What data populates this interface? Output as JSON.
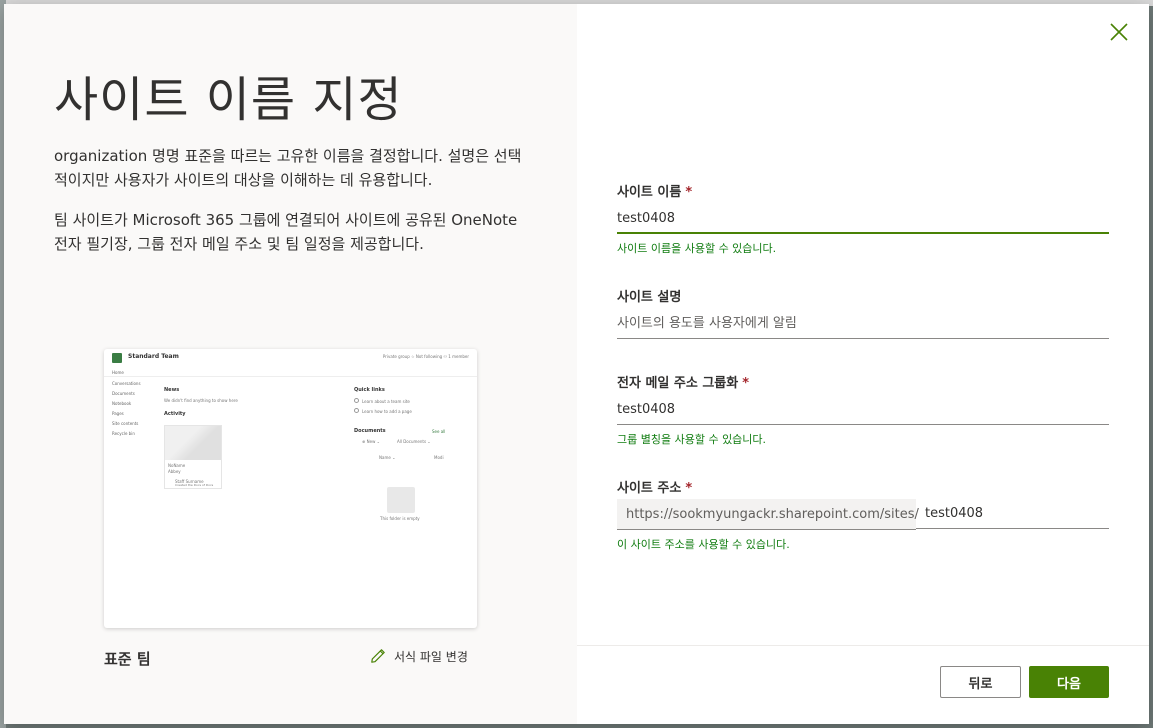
{
  "left": {
    "title": "사이트 이름 지정",
    "description1": "organization 명명 표준을 따르는 고유한 이름을 결정합니다. 설명은 선택적이지만 사용자가 사이트의 대상을 이해하는 데 유용합니다.",
    "description2": "팀 사이트가 Microsoft 365 그룹에 연결되어 사이트에 공유된 OneNote 전자 필기장, 그룹 전자 메일 주소 및 팀 일정을 제공합니다.",
    "template_name": "표준 팀",
    "change_template_label": "서식 파일 변경",
    "preview": {
      "site_title": "Standard Team",
      "top_right": "Private group   ☆ Not following   ⚇ 1 member",
      "nav": [
        "Home",
        "Conversations",
        "Documents",
        "Notebook",
        "Pages",
        "Site contents",
        "Recycle bin"
      ],
      "news_heading": "News",
      "news_text": "We didn't find anything to show here",
      "activity_heading": "Activity",
      "card_title": "NoName",
      "card_sub": "Abbey",
      "card_person": "Staff Surname",
      "card_person_sub": "Created the Docs of Docs",
      "quick_links_heading": "Quick links",
      "quick_link_1": "Learn about a team site",
      "quick_link_2": "Learn how to add a page",
      "documents_heading": "Documents",
      "see_all": "See all",
      "doc_new": "⊕ New ⌄",
      "doc_all": "All Documents ⌄",
      "col_name": "Name ⌄",
      "col_modified": "Modi",
      "empty_text": "This folder is empty"
    }
  },
  "form": {
    "site_name": {
      "label": "사이트 이름",
      "required_mark": "*",
      "value": "test0408",
      "hint": "사이트 이름을 사용할 수 있습니다."
    },
    "site_description": {
      "label": "사이트 설명",
      "placeholder": "사이트의 용도를 사용자에게 알림",
      "value": ""
    },
    "email": {
      "label": "전자 메일 주소 그룹화",
      "required_mark": "*",
      "value": "test0408",
      "hint": "그룹 별칭을 사용할 수 있습니다."
    },
    "site_address": {
      "label": "사이트 주소",
      "required_mark": "*",
      "prefix": "https://sookmyungackr.sharepoint.com/sites/",
      "value": "test0408",
      "hint": "이 사이트 주소를 사용할 수 있습니다."
    }
  },
  "buttons": {
    "back": "뒤로",
    "next": "다음"
  },
  "colors": {
    "accent": "#498205",
    "success_text": "#107c10",
    "required": "#a4262c"
  },
  "icons": {
    "close": "close-icon",
    "edit": "pencil-icon"
  }
}
